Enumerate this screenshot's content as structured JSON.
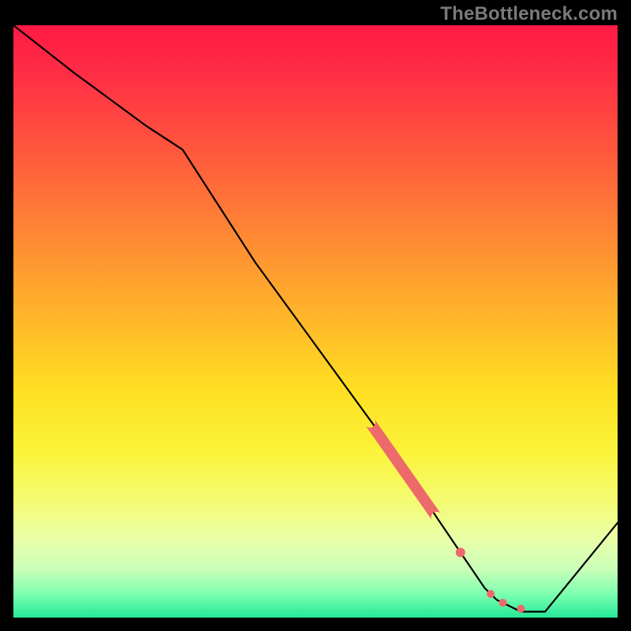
{
  "watermark": "TheBottleneck.com",
  "colors": {
    "background_frame": "#000000",
    "gradient_top": "#ff1a44",
    "gradient_bottom": "#24e89a",
    "curve": "#000000",
    "marker": "#ec6a6a"
  },
  "chart_data": {
    "type": "line",
    "title": "",
    "xlabel": "",
    "ylabel": "",
    "xlim": [
      0,
      100
    ],
    "ylim": [
      0,
      100
    ],
    "grid": false,
    "legend": false,
    "series": [
      {
        "name": "bottleneck-curve",
        "x": [
          0,
          10,
          22,
          28,
          40,
          50,
          60,
          65,
          70,
          74,
          78,
          80,
          84,
          88,
          100
        ],
        "y": [
          100,
          92,
          83,
          79,
          60,
          46,
          32,
          25,
          17,
          11,
          5,
          3,
          1,
          1,
          16
        ]
      }
    ],
    "markers": [
      {
        "name": "dense-band",
        "type": "segment",
        "x_start": 59,
        "y_start": 33,
        "x_end": 70,
        "y_end": 17
      },
      {
        "name": "dot-1",
        "type": "point",
        "x": 74,
        "y": 11
      },
      {
        "name": "dot-2",
        "type": "point",
        "x": 79,
        "y": 4
      },
      {
        "name": "dot-3",
        "type": "point",
        "x": 81,
        "y": 2.5
      },
      {
        "name": "dot-4",
        "type": "point",
        "x": 84,
        "y": 1.5
      }
    ]
  }
}
